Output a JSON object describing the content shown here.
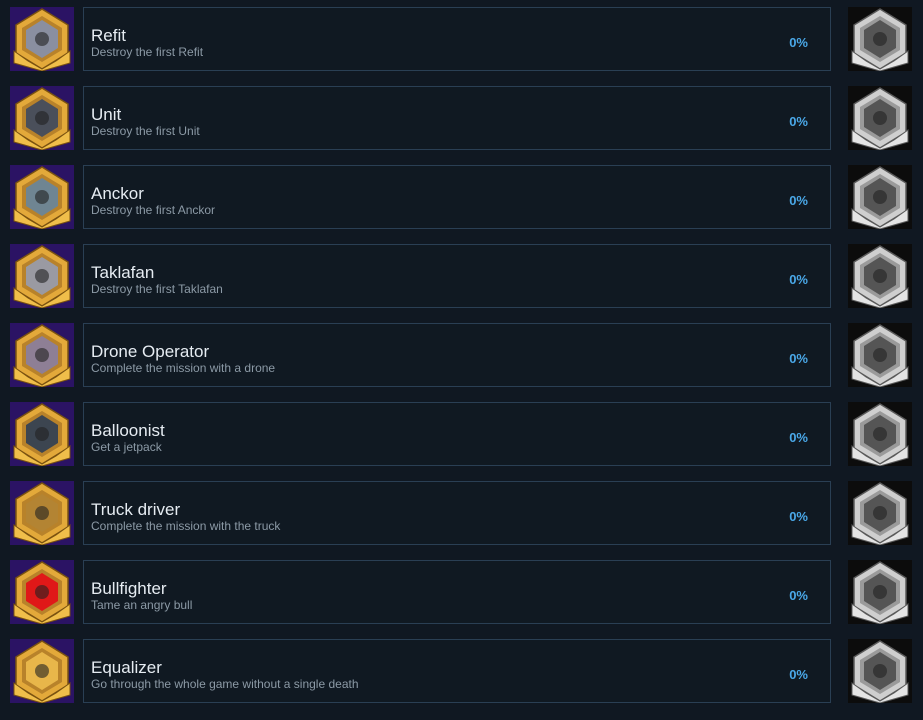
{
  "achievements": [
    {
      "title": "Refit",
      "description": "Destroy the first Refit",
      "progress": "0%",
      "icon": "refit-robot-icon",
      "emblem_color": "#8a8fa0"
    },
    {
      "title": "Unit",
      "description": "Destroy the first Unit",
      "progress": "0%",
      "icon": "unit-robot-icon",
      "emblem_color": "#4a4f5a"
    },
    {
      "title": "Anckor",
      "description": "Destroy the first Anckor",
      "progress": "0%",
      "icon": "anckor-robot-icon",
      "emblem_color": "#6f8592"
    },
    {
      "title": "Taklafan",
      "description": "Destroy the first Taklafan",
      "progress": "0%",
      "icon": "taklafan-robot-icon",
      "emblem_color": "#9a9aa2"
    },
    {
      "title": "Drone Operator",
      "description": "Complete the mission with a drone",
      "progress": "0%",
      "icon": "drone-icon",
      "emblem_color": "#8e7f95"
    },
    {
      "title": "Balloonist",
      "description": "Get a jetpack",
      "progress": "0%",
      "icon": "jetpack-icon",
      "emblem_color": "#3c4550"
    },
    {
      "title": "Truck driver",
      "description": "Complete the mission with the truck",
      "progress": "0%",
      "icon": "truck-icon",
      "emblem_color": "#b38433"
    },
    {
      "title": "Bullfighter",
      "description": "Tame an angry bull",
      "progress": "0%",
      "icon": "bull-icon",
      "emblem_color": "#e01818"
    },
    {
      "title": "Equalizer",
      "description": "Go through the whole game without a single death",
      "progress": "0%",
      "icon": "equalizer-emblem-icon",
      "emblem_color": "#e8b64a"
    }
  ],
  "colors": {
    "background": "#101822",
    "panel_border": "#2a3f54",
    "title": "#e6ecf2",
    "description": "#8c9aa6",
    "progress": "#4aa8e8",
    "gold": "#e3a93a",
    "silver": "#c8c8c8",
    "purple_bg": "#2a1060"
  }
}
